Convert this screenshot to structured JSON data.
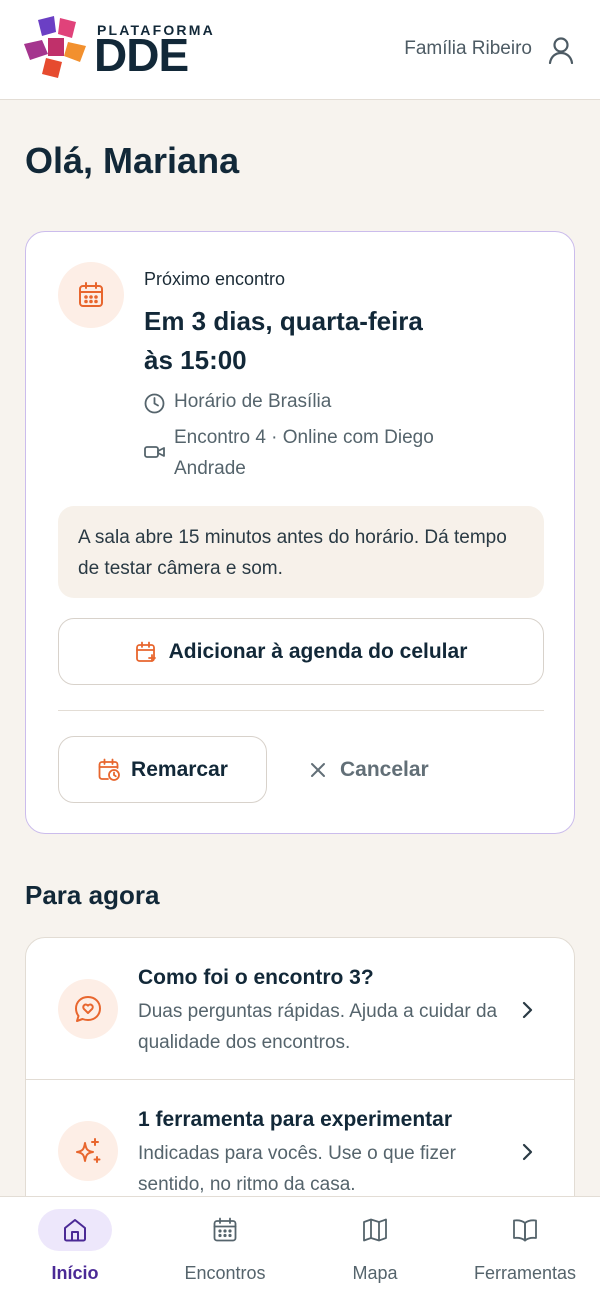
{
  "header": {
    "logo_small": "PLATAFORMA",
    "logo_big": "DDE",
    "family_name": "Família Ribeiro"
  },
  "greeting": "Olá, Mariana",
  "next_meeting": {
    "label": "Próximo encontro",
    "title": "Em 3 dias, quarta-feira às 15:00",
    "timezone": "Horário de Brasília",
    "details": "Encontro 4 · Online com Diego Andrade",
    "tip": "A sala abre 15 minutos antes do horário. Dá tempo de testar câmera e som.",
    "add_calendar_label": "Adicionar à agenda do celular",
    "reschedule_label": "Remarcar",
    "cancel_label": "Cancelar"
  },
  "section": {
    "title": "Para agora",
    "items": [
      {
        "title": "Como foi o encontro 3?",
        "description": "Duas perguntas rápidas. Ajuda a cuidar da qualidade dos encontros.",
        "icon": "heart-chat-icon"
      },
      {
        "title": "1 ferramenta para experimentar",
        "description": "Indicadas para vocês. Use o que fizer sentido, no ritmo da casa.",
        "icon": "sparkle-icon"
      }
    ]
  },
  "nav": {
    "items": [
      {
        "label": "Início",
        "icon": "home-icon",
        "active": true
      },
      {
        "label": "Encontros",
        "icon": "calendar-icon",
        "active": false
      },
      {
        "label": "Mapa",
        "icon": "map-icon",
        "active": false
      },
      {
        "label": "Ferramentas",
        "icon": "book-icon",
        "active": false
      }
    ]
  },
  "colors": {
    "accent": "#e8662e",
    "primary_text": "#122838",
    "active_nav": "#4b2a96",
    "card_border": "#cbbcec",
    "background": "#f7f3ee"
  }
}
